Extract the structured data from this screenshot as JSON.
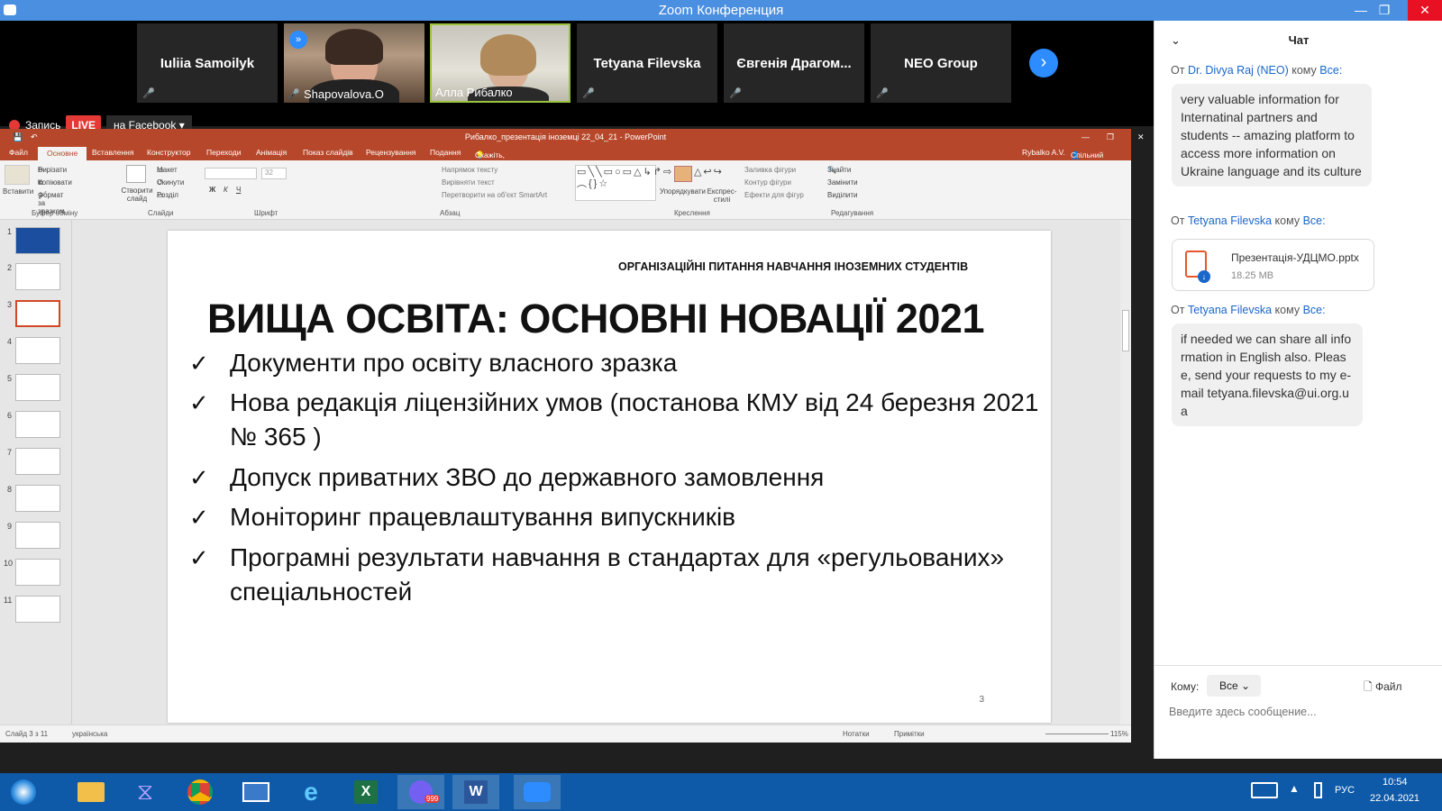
{
  "window": {
    "title": "Zoom Конференция"
  },
  "participants": [
    {
      "name": "Iuliia Samoilyk",
      "muted": true
    },
    {
      "name": "Shapovalova.O",
      "muted": true,
      "video": true
    },
    {
      "name": "Алла Рибалко",
      "muted": false,
      "video": true
    },
    {
      "name": "Tetyana Filevska",
      "muted": true
    },
    {
      "name": "Євгенія Драгом...",
      "muted": true
    },
    {
      "name": "NEO Group",
      "muted": true
    }
  ],
  "recording": {
    "label": "Запись",
    "live": "LIVE",
    "stream_target": "на Facebook"
  },
  "ppt": {
    "title": "Рибалко_презентація іноземці 22_04_21 - PowerPoint",
    "user": "Rybalko A.V.",
    "share": "Спільний доступ",
    "tabs": [
      "Файл",
      "Основне",
      "Вставлення",
      "Конструктор",
      "Переходи",
      "Анімація",
      "Показ слайдів",
      "Рецензування",
      "Подання"
    ],
    "tellme": "Скажіть, що потрібно зробити...",
    "ribbon": {
      "paste": "Вставити",
      "cut": "Вирізати",
      "copy": "Копіювати",
      "format_painter": "Формат за зразком",
      "clipboard": "Буфер обміну",
      "new_slide": "Створити слайд",
      "layout": "Макет",
      "reset": "Скинути",
      "section": "Розділ",
      "slides": "Слайди",
      "font": "Шрифт",
      "font_size": "32",
      "text_dir": "Напрямок тексту",
      "align_text": "Вирівняти текст",
      "smartart": "Перетворити на об'єкт SmartArt",
      "paragraph": "Абзац",
      "arrange": "Упорядкувати",
      "quick_styles": "Експрес-стилі",
      "shape_fill": "Заливка фігури",
      "shape_outline": "Контур фігури",
      "shape_effects": "Ефекти для фігур",
      "drawing": "Креслення",
      "find": "Знайти",
      "replace": "Замінити",
      "select": "Виділити",
      "editing": "Редагування"
    },
    "thumbnails": [
      "1",
      "2",
      "3",
      "4",
      "5",
      "6",
      "7",
      "8",
      "9",
      "10",
      "11"
    ],
    "active_slide": 3,
    "slide": {
      "subtitle": "ОРГАНІЗАЦІЙНІ ПИТАННЯ НАВЧАННЯ ІНОЗЕМНИХ СТУДЕНТІВ",
      "title": "ВИЩА ОСВІТА: ОСНОВНІ НОВАЦІЇ 2021",
      "check": "✓",
      "bullets": [
        "Документи про освіту власного зразка",
        "Нова редакція ліцензійних умов (постанова КМУ від 24 березня 2021 № 365 )",
        "Допуск приватних ЗВО до державного замовлення",
        "Моніторинг працевлаштування випускників",
        "Програмні результати навчання в стандартах для «регульованих» спеціальностей"
      ],
      "number": "3"
    },
    "status": {
      "slide_info": "Слайд 3 з 11",
      "language": "українська",
      "notes": "Нотатки",
      "comments": "Примітки",
      "zoom": "115%"
    }
  },
  "chat": {
    "title": "Чат",
    "from_prefix": "От",
    "to_word": "кому",
    "messages": [
      {
        "from": "Dr. Divya Raj (NEO)",
        "to": "Все:",
        "text": "very valuable information for Internatinal partners and students -- amazing platform to access more information on Ukraine language and its culture"
      },
      {
        "from": "Tetyana Filevska",
        "to": "Все:",
        "file_name": "Презентація-УДЦМО.pptx",
        "file_size": "18.25 MB"
      },
      {
        "from": "Tetyana Filevska",
        "to": "Все:",
        "text": "if needed we can share all information in English also. Please, send your requests to my e-mail tetyana.filevska@ui.org.ua"
      }
    ],
    "to_label": "Кому:",
    "to_value": "Все",
    "file_button": "Файл",
    "input_placeholder": "Введите здесь сообщение..."
  },
  "taskbar": {
    "lang": "РУС",
    "time": "10:54",
    "date": "22.04.2021",
    "viber_badge": "999"
  },
  "colors": {
    "zoom_blue": "#4a8fe0",
    "ppt_red": "#b7472a",
    "live_red": "#e53935",
    "taskbar": "#0f5aa8",
    "chat_link": "#1a66c9"
  }
}
